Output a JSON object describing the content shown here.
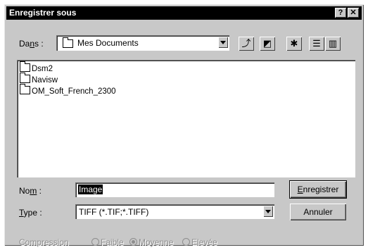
{
  "window": {
    "title": "Enregistrer sous",
    "help_label": "?",
    "close_label": "✕"
  },
  "location": {
    "label_prefix": "Da",
    "label_underlined": "n",
    "label_suffix": "s :",
    "value": "Mes Documents"
  },
  "files": [
    {
      "name": "Dsm2"
    },
    {
      "name": "Navisw"
    },
    {
      "name": "OM_Soft_French_2300"
    }
  ],
  "filename": {
    "label_prefix": "No",
    "label_underlined": "m",
    "label_suffix": " :",
    "value": "Image"
  },
  "filetype": {
    "label_underlined": "T",
    "label_suffix": "ype :",
    "value": "TIFF (*.TIF;*.TIFF)"
  },
  "buttons": {
    "save_underlined": "E",
    "save_suffix": "nregistrer",
    "cancel": "Annuler"
  },
  "compression": {
    "label": "Compression",
    "options": [
      {
        "label": "Faible",
        "selected": false
      },
      {
        "label": "Moyenne",
        "selected": true
      },
      {
        "label": "Elevée",
        "selected": false
      }
    ]
  }
}
